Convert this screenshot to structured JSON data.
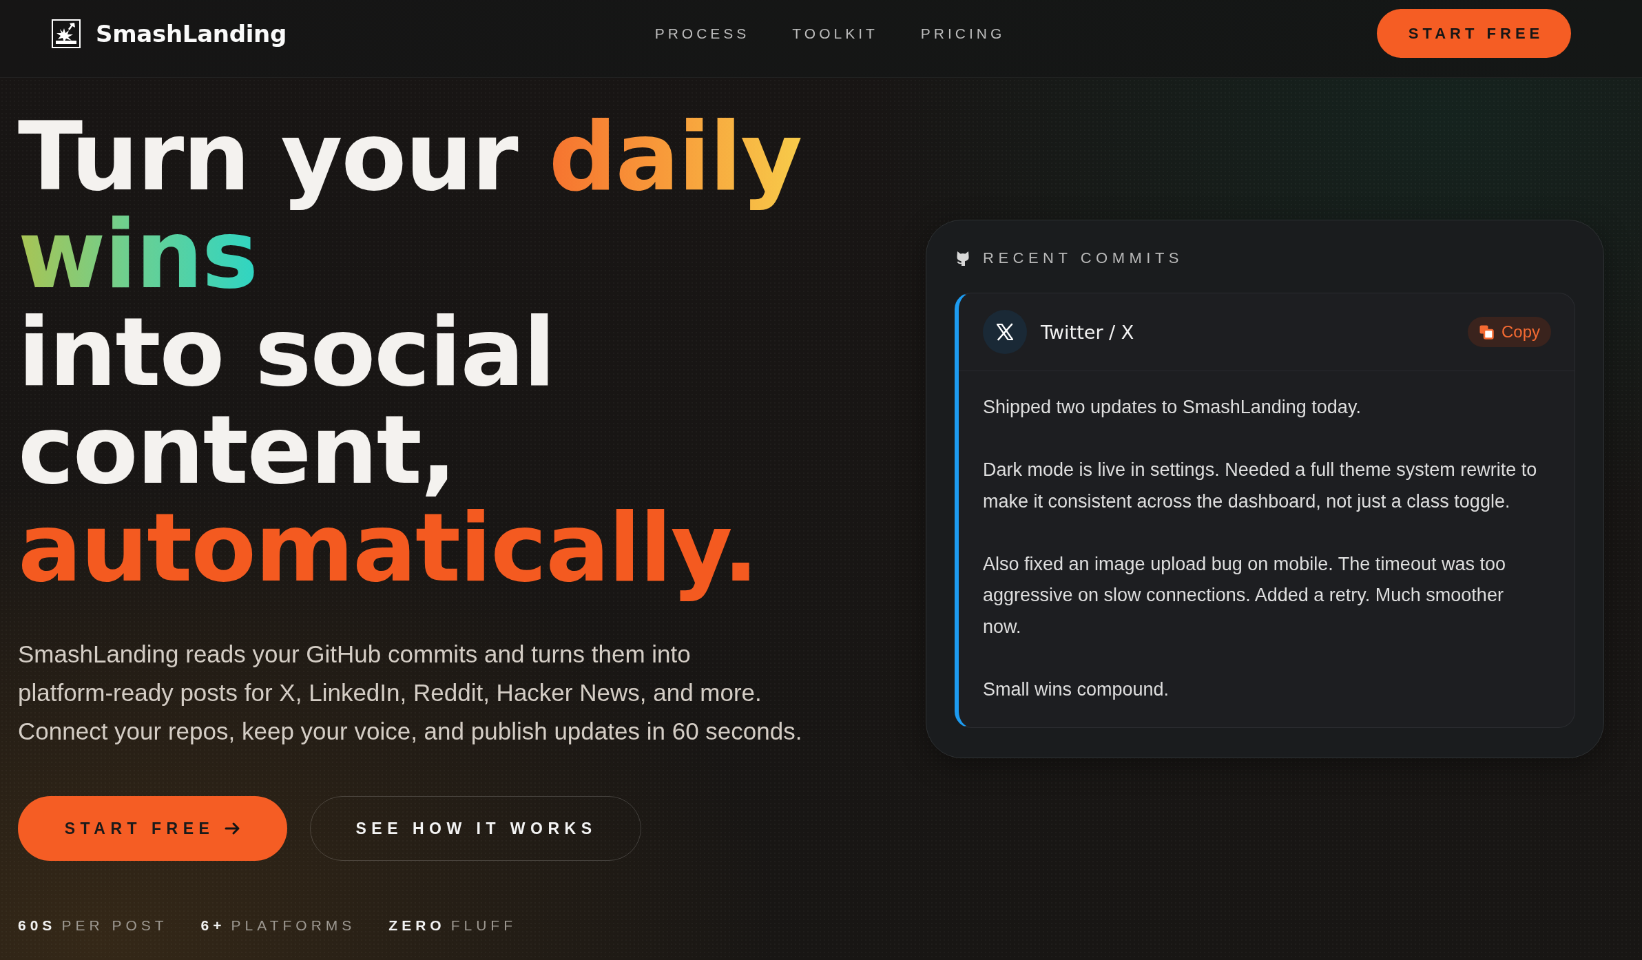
{
  "header": {
    "brand": "SmashLanding",
    "nav": [
      "PROCESS",
      "TOOLKIT",
      "PRICING"
    ],
    "cta": "START FREE"
  },
  "hero": {
    "headline": [
      [
        {
          "text": "Turn your",
          "kind": "plain"
        },
        {
          "text": "daily",
          "kind": "sunrise"
        }
      ],
      [
        {
          "text": "wins",
          "kind": "mint"
        }
      ],
      [
        {
          "text": "into social",
          "kind": "plain"
        }
      ],
      [
        {
          "text": "content,",
          "kind": "plain"
        }
      ],
      [
        {
          "text": "automatically.",
          "kind": "accent"
        }
      ]
    ],
    "description": "SmashLanding reads your GitHub commits and turns them into platform-ready posts for X, LinkedIn, Reddit, Hacker News, and more. Connect your repos, keep your voice, and publish updates in 60 seconds.",
    "buttons": [
      {
        "label": "START FREE",
        "kind": "primary"
      },
      {
        "label": "SEE HOW IT WORKS",
        "kind": "outline"
      }
    ],
    "stats": [
      {
        "value": "60S",
        "label": "PER POST"
      },
      {
        "value": "6+",
        "label": "PLATFORMS"
      },
      {
        "value": "ZERO",
        "label": "FLUFF"
      }
    ]
  },
  "commits": {
    "title": "RECENT COMMITS",
    "post": {
      "platform": "Twitter / X",
      "copy_label": "Copy",
      "paragraphs": [
        "Shipped two updates to SmashLanding today.",
        "Dark mode is live in settings. Needed a full theme system rewrite to make it consistent across the dashboard, not just a class toggle.",
        "Also fixed an image upload bug on mobile. The timeout was too aggressive on slow connections. Added a retry. Much smoother now.",
        "Small wins compound."
      ]
    }
  }
}
